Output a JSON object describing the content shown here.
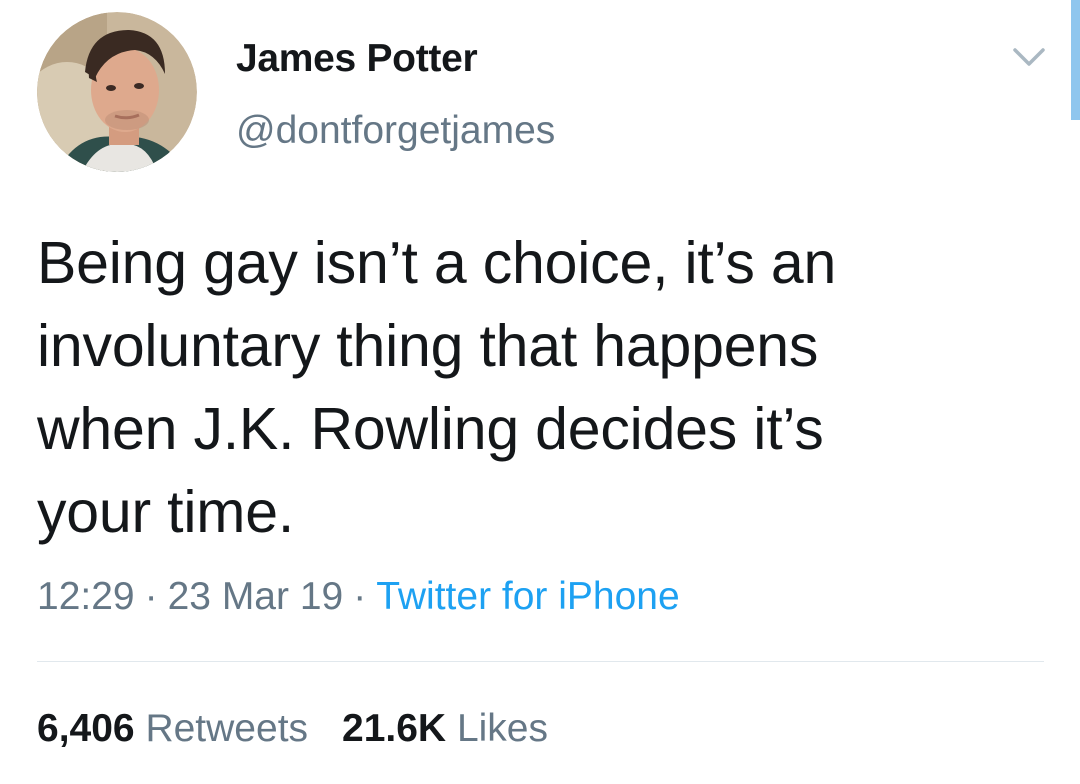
{
  "tweet": {
    "author": {
      "display_name": "James Potter",
      "handle": "@dontforgetjames"
    },
    "text": "Being gay isn’t a choice, it’s an\ninvoluntary thing that happens\nwhen J.K. Rowling decides it’s\nyour time.",
    "time": "12:29",
    "date": "23 Mar 19",
    "separator": "·",
    "source": "Twitter for iPhone",
    "stats": {
      "retweets_count": "6,406",
      "retweets_label": "Retweets",
      "likes_count": "21.6K",
      "likes_label": "Likes"
    }
  },
  "icons": {
    "menu": "chevron-down-icon",
    "avatar": "avatar-photo"
  },
  "colors": {
    "text_primary": "#14171a",
    "text_secondary": "#657786",
    "link": "#1da1f2",
    "divider": "#e1e8ed"
  }
}
